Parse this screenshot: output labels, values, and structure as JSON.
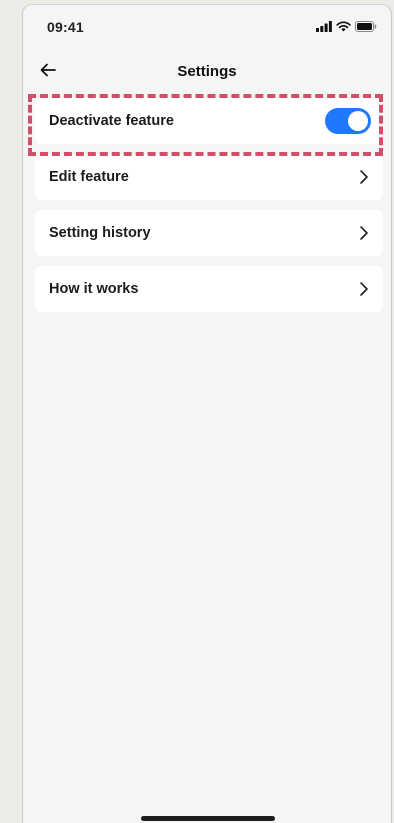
{
  "status_bar": {
    "time": "09:41",
    "icons": [
      "signal-icon",
      "wifi-icon",
      "battery-icon"
    ]
  },
  "nav": {
    "title": "Settings",
    "back_icon": "arrow-left-icon"
  },
  "settings": {
    "items": [
      {
        "label": "Deactivate feature",
        "control": "toggle",
        "toggle_on": true
      },
      {
        "label": "Edit feature",
        "control": "chevron"
      },
      {
        "label": "Setting history",
        "control": "chevron"
      },
      {
        "label": "How it works",
        "control": "chevron"
      }
    ]
  },
  "colors": {
    "toggle_on": "#1f79ff",
    "highlight_dash": "#d24f6a",
    "screen_bg": "#f5f5f5",
    "row_bg": "#ffffff"
  }
}
